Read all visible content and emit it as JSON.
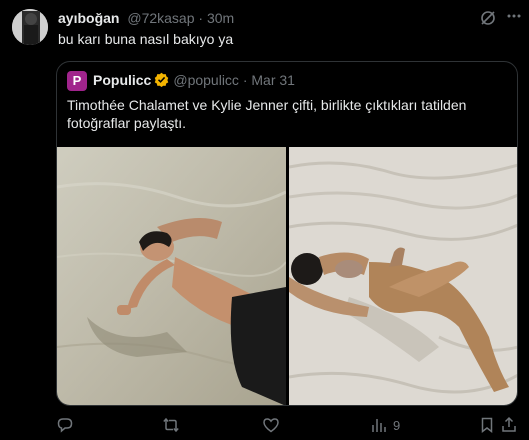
{
  "tweet": {
    "author_name": "ayıboğan",
    "author_handle": "@72kasap",
    "separator": "·",
    "time": "30m",
    "text": "bu karı buna nasıl bakıyo ya"
  },
  "quoted": {
    "logo_letter": "P",
    "author_name": "Populicc",
    "author_handle": "@populicc",
    "separator": "·",
    "date": "Mar 31",
    "text": "Timothée Chalamet ve Kylie Jenner çifti, birlikte çıktıkları tatilden fotoğraflar paylaştı."
  },
  "actions": {
    "views_count": "9"
  },
  "colors": {
    "background": "#000000",
    "text": "#e7e9ea",
    "muted": "#71767b",
    "border": "#2f3336",
    "verified": "#f4b400",
    "brand": "#a0248c"
  },
  "icons": [
    "grok-icon",
    "more-icon",
    "verified-badge-icon",
    "reply-icon",
    "retweet-icon",
    "like-icon",
    "views-icon",
    "bookmark-icon",
    "share-icon"
  ]
}
